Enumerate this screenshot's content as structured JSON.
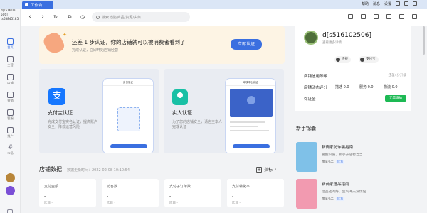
{
  "app": {
    "home_tab": "工作台",
    "top_links": [
      "帮助",
      "消息",
      "设置"
    ]
  },
  "search": {
    "placeholder": "搜索功能/商品/资源/头条"
  },
  "sidebar": {
    "user_line1": "d[s516102",
    "user_line2": "506]",
    "user_line3": "ts63845185",
    "items": [
      {
        "label": "首页",
        "icon": "home-icon"
      },
      {
        "label": "主营",
        "icon": "shop-icon"
      },
      {
        "label": "店铺",
        "icon": "store-icon"
      },
      {
        "label": "营销",
        "icon": "megaphone-icon"
      },
      {
        "label": "客服",
        "icon": "headset-icon"
      },
      {
        "label": "推广",
        "icon": "chart-icon"
      },
      {
        "label": "市场",
        "icon": "hash-icon"
      }
    ]
  },
  "banner": {
    "title": "还差 1 步认证，你的店铺就可以被消费者看到了",
    "subtitle": "完成认证，立即开始店铺经营",
    "button": "立即认证"
  },
  "cards": [
    {
      "title": "支付宝认证",
      "desc": "完成支付宝实名认证，提高账户安全，降低运营风险",
      "phone_header": "身份验证"
    },
    {
      "title": "实人认证",
      "desc": "为了您的店铺安全，请店主本人完成认证",
      "phone_header": "审核中心认证"
    }
  ],
  "store_data": {
    "title": "店铺数据",
    "update_time": "数据更新时间：2022-02-08 10:10:54",
    "indicator_label": "指标",
    "metrics": [
      {
        "label": "支付金额",
        "value": "-",
        "compare": "昨日 -"
      },
      {
        "label": "访客数",
        "value": "-",
        "compare": "昨日 -"
      },
      {
        "label": "支付子订单数",
        "value": "-",
        "compare": "昨日 -"
      },
      {
        "label": "支付转化率",
        "value": "-",
        "compare": "昨日 -"
      }
    ]
  },
  "store_panel": {
    "name": "d[s516102506]",
    "sub": "查看更多详情",
    "pill1": "连接",
    "pill2": "支付宝",
    "rows": [
      {
        "label": "店铺信用等级",
        "right": "还差4分升级"
      },
      {
        "label": "店铺动态评分",
        "s1": "描述 0.0 -",
        "s2": "服务 0.0 -",
        "s3": "物流 0.0 -"
      },
      {
        "label": "保证金",
        "badge": "无需缴纳"
      }
    ]
  },
  "guide": {
    "title": "新手锦囊",
    "items": [
      {
        "title": "新商家防诈骗指南",
        "desc": "警醒识骗，新手开店稳当当",
        "author": "淘宝小二",
        "tag": "官方"
      },
      {
        "title": "新商家选品指南",
        "desc": "选品选的好，生气冲天没烦恼",
        "author": "淘宝小二",
        "tag": "官方"
      }
    ]
  },
  "colors": {
    "accent": "#3a6fe0",
    "banner_bg": "#fdf4e4",
    "badge_green": "#1db954"
  }
}
